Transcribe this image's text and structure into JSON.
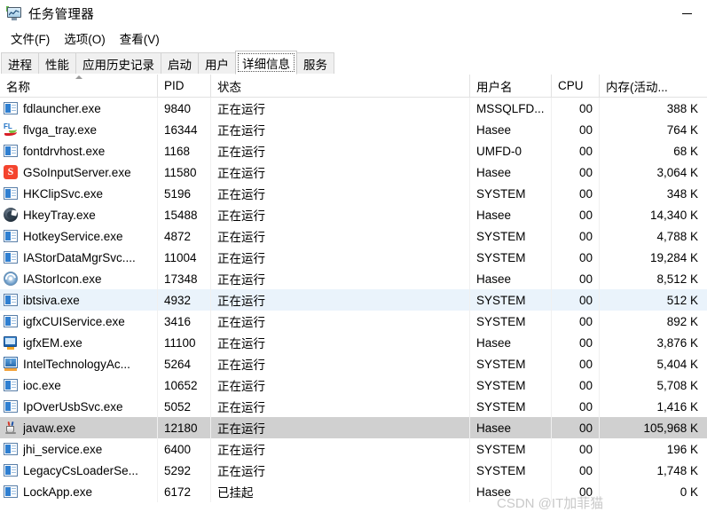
{
  "window": {
    "title": "任务管理器",
    "icon": "taskmanager-icon",
    "controls": [
      {
        "name": "minimize-button",
        "glyph": "—"
      }
    ]
  },
  "menu": {
    "items": [
      {
        "name": "menu-file",
        "label": "文件(F)"
      },
      {
        "name": "menu-options",
        "label": "选项(O)"
      },
      {
        "name": "menu-view",
        "label": "查看(V)"
      }
    ]
  },
  "tabs": {
    "selected": "详细信息",
    "items": [
      {
        "name": "tab-processes",
        "label": "进程"
      },
      {
        "name": "tab-performance",
        "label": "性能"
      },
      {
        "name": "tab-app-history",
        "label": "应用历史记录"
      },
      {
        "name": "tab-startup",
        "label": "启动"
      },
      {
        "name": "tab-users",
        "label": "用户"
      },
      {
        "name": "tab-details",
        "label": "详细信息"
      },
      {
        "name": "tab-services",
        "label": "服务"
      }
    ]
  },
  "table": {
    "sort_column": "名称",
    "sort_direction": "ascending",
    "columns": [
      {
        "name": "column-name",
        "label": "名称"
      },
      {
        "name": "column-pid",
        "label": "PID"
      },
      {
        "name": "column-status",
        "label": "状态"
      },
      {
        "name": "column-username",
        "label": "用户名"
      },
      {
        "name": "column-cpu",
        "label": "CPU"
      },
      {
        "name": "column-memory",
        "label": "内存(活动..."
      }
    ],
    "rows": [
      {
        "icon": "exe",
        "name": "fdlauncher.exe",
        "pid": "9840",
        "status": "正在运行",
        "user": "MSSQLFD...",
        "cpu": "00",
        "memory": "388 K",
        "state": "normal"
      },
      {
        "icon": "fl",
        "name": "flvga_tray.exe",
        "pid": "16344",
        "status": "正在运行",
        "user": "Hasee",
        "cpu": "00",
        "memory": "764 K",
        "state": "normal"
      },
      {
        "icon": "exe",
        "name": "fontdrvhost.exe",
        "pid": "1168",
        "status": "正在运行",
        "user": "UMFD-0",
        "cpu": "00",
        "memory": "68 K",
        "state": "normal"
      },
      {
        "icon": "sogou",
        "name": "GSoInputServer.exe",
        "pid": "11580",
        "status": "正在运行",
        "user": "Hasee",
        "cpu": "00",
        "memory": "3,064 K",
        "state": "normal"
      },
      {
        "icon": "exe",
        "name": "HKClipSvc.exe",
        "pid": "5196",
        "status": "正在运行",
        "user": "SYSTEM",
        "cpu": "00",
        "memory": "348 K",
        "state": "normal"
      },
      {
        "icon": "hkey",
        "name": "HkeyTray.exe",
        "pid": "15488",
        "status": "正在运行",
        "user": "Hasee",
        "cpu": "00",
        "memory": "14,340 K",
        "state": "normal"
      },
      {
        "icon": "exe",
        "name": "HotkeyService.exe",
        "pid": "4872",
        "status": "正在运行",
        "user": "SYSTEM",
        "cpu": "00",
        "memory": "4,788 K",
        "state": "normal"
      },
      {
        "icon": "exe",
        "name": "IAStorDataMgrSvc....",
        "pid": "11004",
        "status": "正在运行",
        "user": "SYSTEM",
        "cpu": "00",
        "memory": "19,284 K",
        "state": "normal"
      },
      {
        "icon": "iastor",
        "name": "IAStorIcon.exe",
        "pid": "17348",
        "status": "正在运行",
        "user": "Hasee",
        "cpu": "00",
        "memory": "8,512 K",
        "state": "normal"
      },
      {
        "icon": "exe",
        "name": "ibtsiva.exe",
        "pid": "4932",
        "status": "正在运行",
        "user": "SYSTEM",
        "cpu": "00",
        "memory": "512 K",
        "state": "hover"
      },
      {
        "icon": "exe",
        "name": "igfxCUIService.exe",
        "pid": "3416",
        "status": "正在运行",
        "user": "SYSTEM",
        "cpu": "00",
        "memory": "892 K",
        "state": "normal"
      },
      {
        "icon": "igfx",
        "name": "igfxEM.exe",
        "pid": "11100",
        "status": "正在运行",
        "user": "Hasee",
        "cpu": "00",
        "memory": "3,876 K",
        "state": "normal"
      },
      {
        "icon": "intel",
        "name": "IntelTechnologyAc...",
        "pid": "5264",
        "status": "正在运行",
        "user": "SYSTEM",
        "cpu": "00",
        "memory": "5,404 K",
        "state": "normal"
      },
      {
        "icon": "exe",
        "name": "ioc.exe",
        "pid": "10652",
        "status": "正在运行",
        "user": "SYSTEM",
        "cpu": "00",
        "memory": "5,708 K",
        "state": "normal"
      },
      {
        "icon": "exe",
        "name": "IpOverUsbSvc.exe",
        "pid": "5052",
        "status": "正在运行",
        "user": "SYSTEM",
        "cpu": "00",
        "memory": "1,416 K",
        "state": "normal"
      },
      {
        "icon": "java",
        "name": "javaw.exe",
        "pid": "12180",
        "status": "正在运行",
        "user": "Hasee",
        "cpu": "00",
        "memory": "105,968 K",
        "state": "selected"
      },
      {
        "icon": "exe",
        "name": "jhi_service.exe",
        "pid": "6400",
        "status": "正在运行",
        "user": "SYSTEM",
        "cpu": "00",
        "memory": "196 K",
        "state": "normal"
      },
      {
        "icon": "exe",
        "name": "LegacyCsLoaderSe...",
        "pid": "5292",
        "status": "正在运行",
        "user": "SYSTEM",
        "cpu": "00",
        "memory": "1,748 K",
        "state": "normal"
      },
      {
        "icon": "exe",
        "name": "LockApp.exe",
        "pid": "6172",
        "status": "已挂起",
        "user": "Hasee",
        "cpu": "00",
        "memory": "0 K",
        "state": "normal"
      }
    ]
  },
  "watermark": {
    "text": "CSDN @IT加菲猫"
  }
}
